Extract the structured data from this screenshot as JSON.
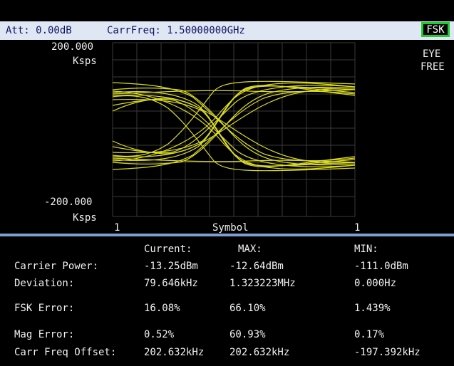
{
  "status": {
    "attenuation": "Att: 0.00dB",
    "carrier_freq": "CarrFreq: 1.50000000GHz",
    "mode": "FSK"
  },
  "plot": {
    "y_top_value": "200.000",
    "y_top_unit": "Ksps",
    "y_bottom_value": "-200.000",
    "y_bottom_unit": "Ksps",
    "x_left": "1",
    "x_right": "1",
    "x_label": "Symbol",
    "display_mode_line1": "EYE",
    "display_mode_line2": "FREE",
    "trace_color": "#f2f228",
    "grid_color": "#3a3a3a"
  },
  "results": {
    "headers": [
      "Current:",
      "MAX:",
      "MIN:"
    ],
    "rows": [
      {
        "label": "Carrier Power:",
        "current": "-13.25dBm",
        "max": "-12.64dBm",
        "min": "-111.0dBm"
      },
      {
        "label": "Deviation:",
        "current": "79.646kHz",
        "max": "1.323223MHz",
        "min": "0.000Hz"
      },
      {
        "label": "FSK Error:",
        "current": "16.08%",
        "max": "66.10%",
        "min": "1.439%"
      },
      {
        "label": "Mag Error:",
        "current": "0.52%",
        "max": "60.93%",
        "min": "0.17%"
      },
      {
        "label": "Carr Freq Offset:",
        "current": "202.632kHz",
        "max": "202.632kHz",
        "min": "-197.392kHz"
      }
    ]
  }
}
